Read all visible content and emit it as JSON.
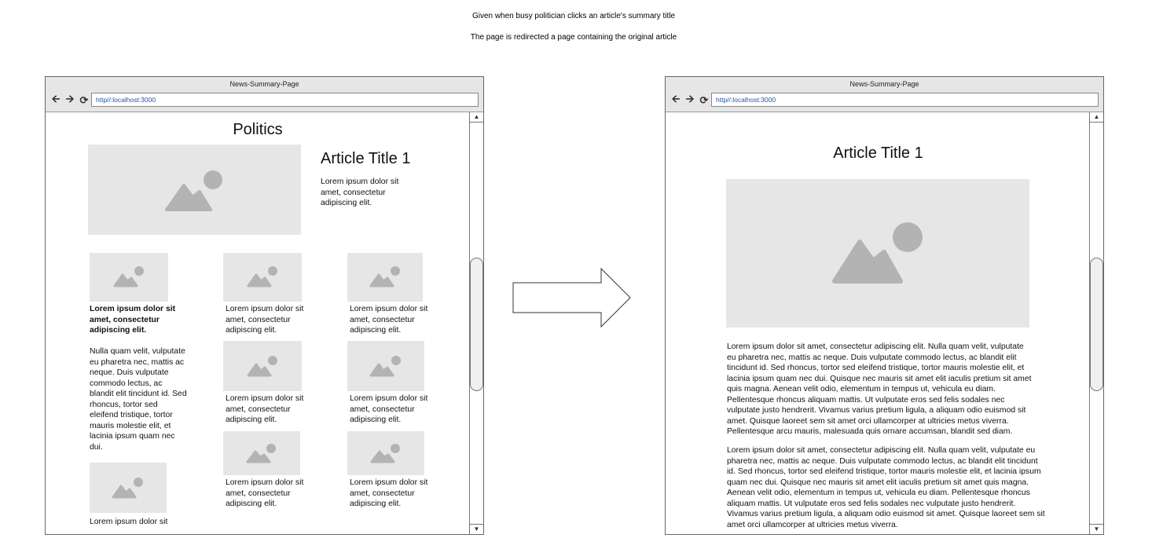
{
  "captions": {
    "line1": "Given when busy politician clicks an article's summary title",
    "line2": "The page is redirected a page containing the original article"
  },
  "left_browser": {
    "window_title": "News-Summary-Page",
    "url": "http//:localhost:3000",
    "page_title": "Politics",
    "featured": {
      "title": "Article Title 1",
      "summary": "Lorem ipsum dolor sit amet, consectetur adipiscing elit."
    },
    "col1": {
      "bold_summary": "Lorem ipsum dolor sit amet, consectetur adipiscing elit.",
      "body": " Nulla quam velit, vulputate eu pharetra nec, mattis ac neque. Duis vulputate commodo lectus, ac blandit elit tincidunt id. Sed rhoncus, tortor sed eleifend tristique, tortor mauris molestie elit, et lacinia ipsum quam nec dui.",
      "bottom_summary": "Lorem ipsum dolor sit"
    },
    "grid_items": [
      "Lorem ipsum dolor sit amet, consectetur adipiscing elit.",
      "Lorem ipsum dolor sit amet, consectetur adipiscing elit.",
      "Lorem ipsum dolor sit amet, consectetur adipiscing elit.",
      "Lorem ipsum dolor sit amet, consectetur adipiscing elit.",
      "Lorem ipsum dolor sit amet, consectetur adipiscing elit.",
      "Lorem ipsum dolor sit amet, consectetur adipiscing elit."
    ]
  },
  "right_browser": {
    "window_title": "News-Summary-Page",
    "url": "http//:localhost:3000",
    "article_title": "Article Title 1",
    "paragraph1": "Lorem ipsum dolor sit amet, consectetur adipiscing elit. Nulla quam velit, vulputate eu pharetra nec, mattis ac neque. Duis vulputate commodo lectus, ac blandit elit tincidunt id. Sed rhoncus, tortor sed eleifend tristique, tortor mauris molestie elit, et lacinia ipsum quam nec dui. Quisque nec mauris sit amet elit iaculis pretium sit amet quis magna. Aenean velit odio, elementum in tempus ut, vehicula eu diam. Pellentesque rhoncus aliquam mattis. Ut vulputate eros sed felis sodales nec vulputate justo hendrerit. Vivamus varius pretium ligula, a aliquam odio euismod sit amet. Quisque laoreet sem sit amet orci ullamcorper at ultricies metus viverra. Pellentesque arcu mauris, malesuada quis ornare accumsan, blandit sed diam.",
    "paragraph2": "Lorem ipsum dolor sit amet, consectetur adipiscing elit. Nulla quam velit, vulputate eu pharetra nec, mattis ac neque. Duis vulputate commodo lectus, ac blandit elit tincidunt id. Sed rhoncus, tortor sed eleifend tristique, tortor mauris molestie elit, et lacinia ipsum quam nec dui. Quisque nec mauris sit amet elit iaculis pretium sit amet quis magna. Aenean velit odio, elementum in tempus ut, vehicula eu diam. Pellentesque rhoncus aliquam mattis. Ut vulputate eros sed felis sodales nec vulputate justo hendrerit. Vivamus varius pretium ligula, a aliquam odio euismod sit amet. Quisque laoreet sem sit amet orci ullamcorper at ultricies metus viverra."
  },
  "icons": {
    "back": "arrow-left-icon",
    "forward": "arrow-right-icon",
    "reload": "reload-icon",
    "placeholder": "image-placeholder-icon",
    "transition": "right-arrow-icon"
  },
  "colors": {
    "placeholder_bg": "#e6e6e6",
    "placeholder_fg": "#b3b3b3",
    "chrome_bg": "#e6e6e6",
    "url_text": "#2255aa"
  }
}
